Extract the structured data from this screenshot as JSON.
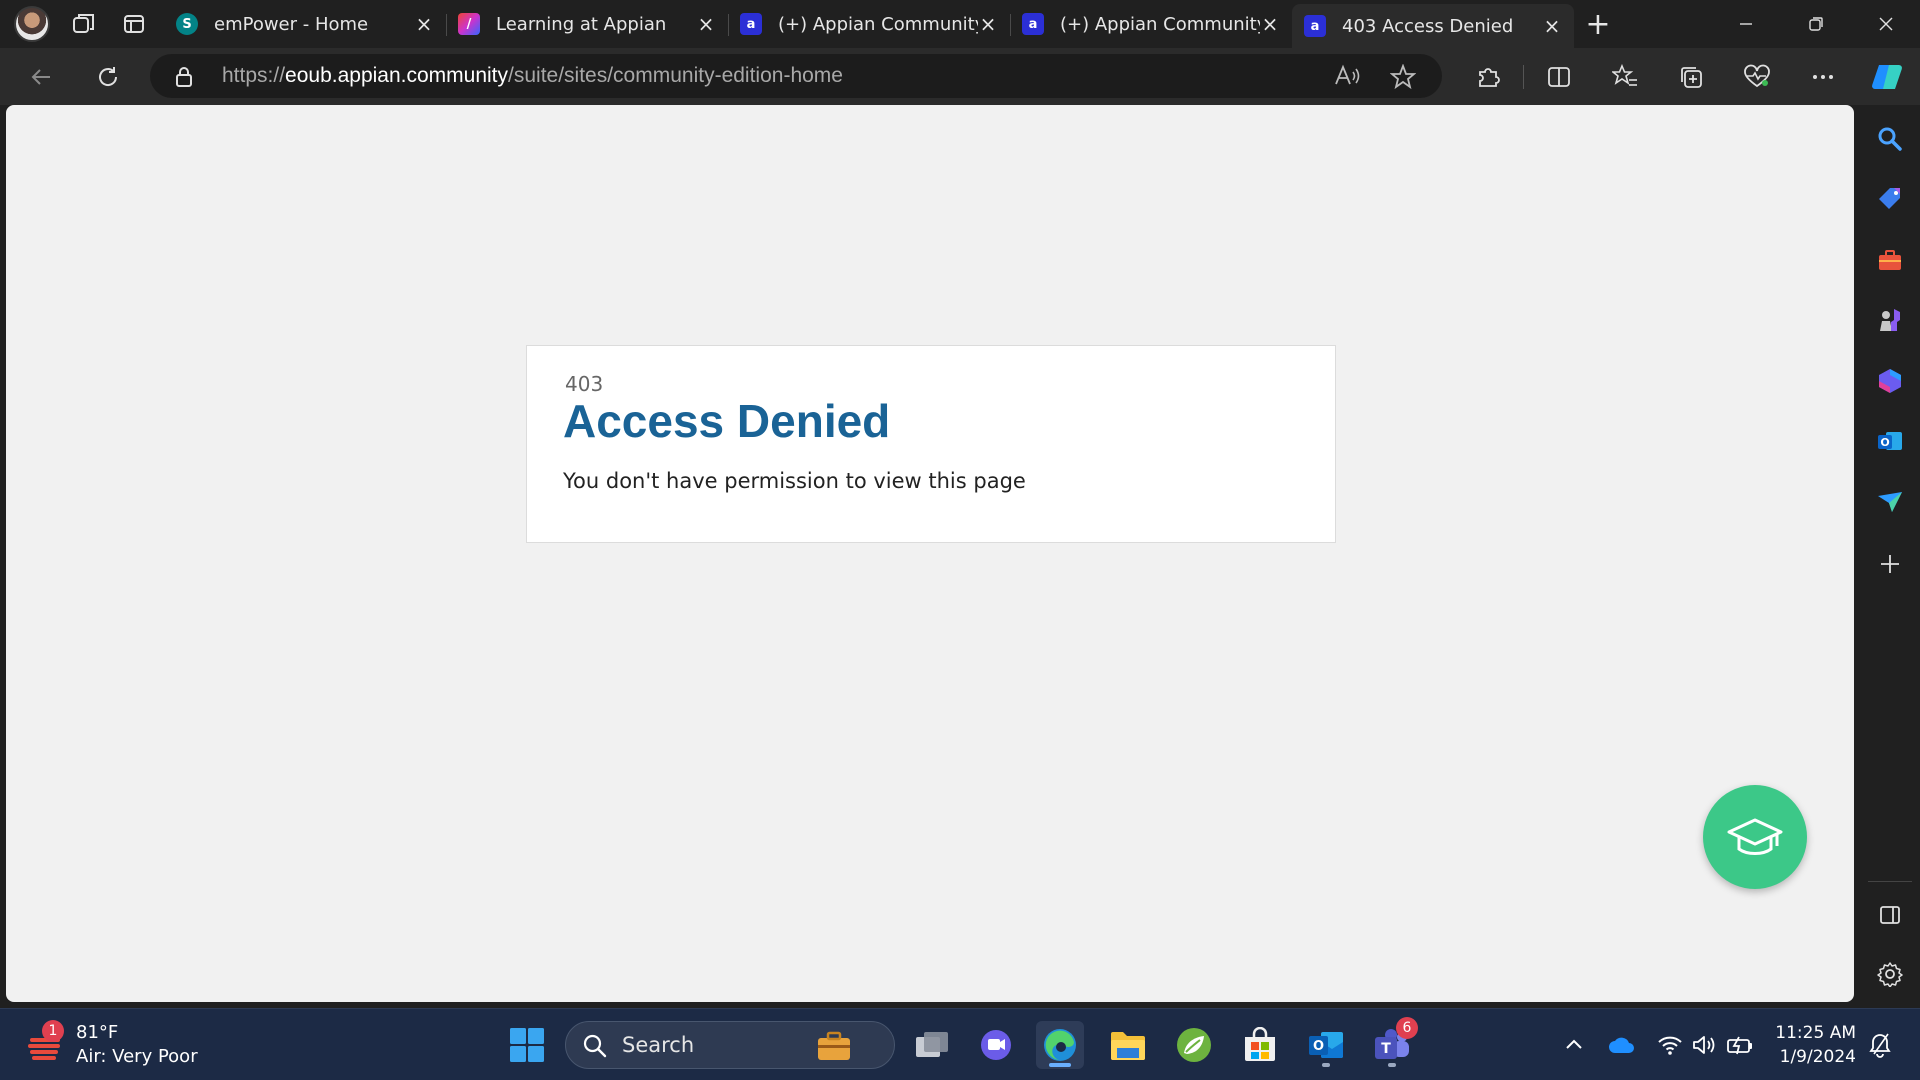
{
  "browser": {
    "tabs": [
      {
        "label": "emPower - Home",
        "favicon": "sharepoint-icon",
        "active": false
      },
      {
        "label": "Learning at Appian",
        "favicon": "appian-academy-icon",
        "active": false
      },
      {
        "label": "(+) Appian Community",
        "favicon": "appian-community-icon",
        "active": false
      },
      {
        "label": "(+) Appian Community",
        "favicon": "appian-community-icon",
        "active": false
      },
      {
        "label": "403 Access Denied",
        "favicon": "appian-icon",
        "active": true
      }
    ],
    "url": {
      "scheme": "https://",
      "host": "eoub.appian.community",
      "path": "/suite/sites/community-edition-home"
    }
  },
  "page": {
    "error_code": "403",
    "title": "Access Denied",
    "message": "You don't have permission to view this page"
  },
  "taskbar": {
    "weather": {
      "temp": "81°F",
      "condition": "Air: Very Poor",
      "badge": "1"
    },
    "search_label": "Search",
    "teams_badge": "6",
    "clock": {
      "time": "11:25 AM",
      "date": "1/9/2024"
    }
  },
  "colors": {
    "title_blue": "#1a6396",
    "fab_green": "#3cc888",
    "taskbar_bg": "#1c2a45"
  }
}
